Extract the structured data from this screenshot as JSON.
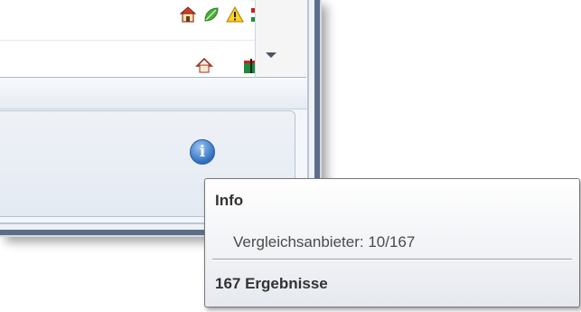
{
  "list": {
    "rows": [
      {
        "icons": [
          "house-icon",
          "leaf-icon",
          "warning-icon",
          "flag-icon"
        ]
      },
      {
        "icons": [
          "house-outline-icon",
          "flag-icon"
        ]
      }
    ]
  },
  "info_button": {
    "glyph": "i",
    "icon": "info-icon"
  },
  "tooltip": {
    "title": "Info",
    "body": "Vergleichsanbieter: 10/167",
    "footer": "167 Ergebnisse"
  },
  "colors": {
    "accent": "#2f6fbf",
    "window_border": "#5a6e8c",
    "tooltip_border": "#767676"
  }
}
